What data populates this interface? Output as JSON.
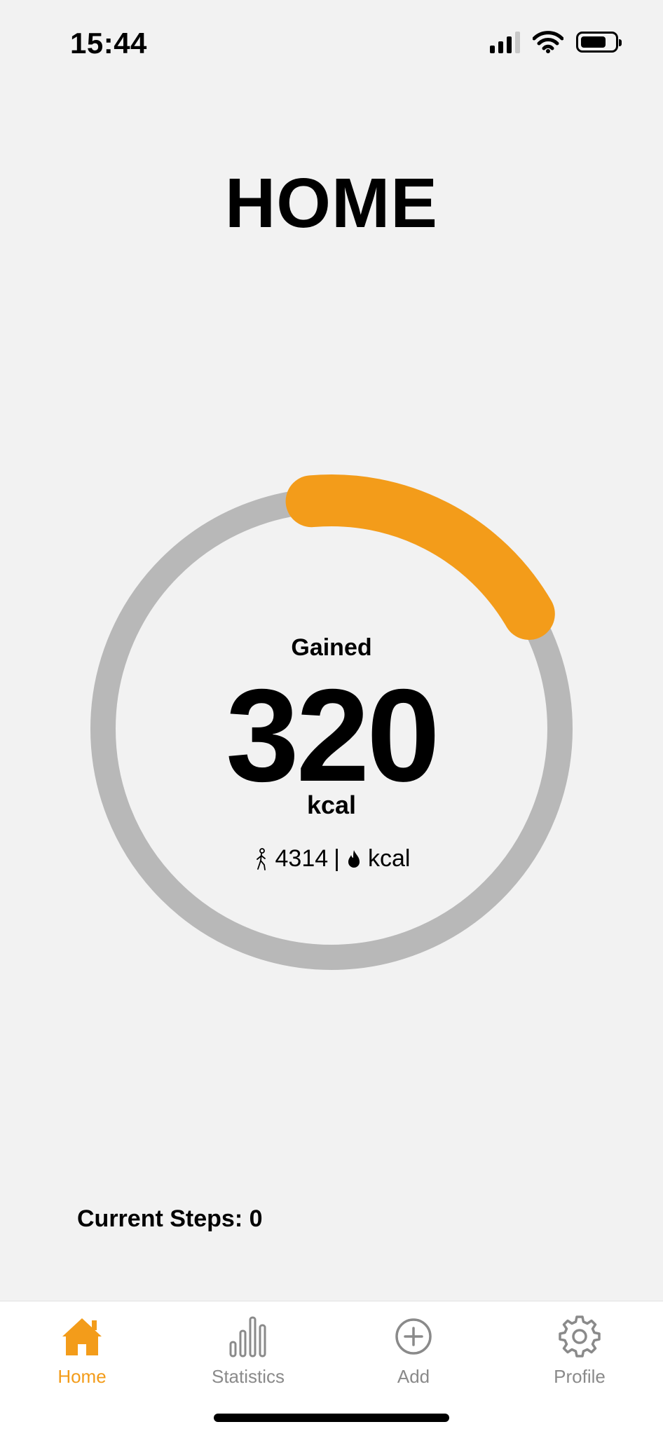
{
  "status_bar": {
    "time": "15:44",
    "battery_level": 0.75
  },
  "page": {
    "title": "HOME"
  },
  "ring": {
    "label": "Gained",
    "value": "320",
    "unit": "kcal",
    "steps": "4314",
    "separator": "|",
    "burned_unit": "kcal",
    "progress_fraction": 0.18,
    "track_color": "#b8b8b8",
    "progress_color": "#f39c1a"
  },
  "current_steps": {
    "text": "Current Steps: 0"
  },
  "tabs": [
    {
      "label": "Home",
      "icon": "home-icon",
      "active": true
    },
    {
      "label": "Statistics",
      "icon": "bar-chart-icon",
      "active": false
    },
    {
      "label": "Add",
      "icon": "plus-circle-icon",
      "active": false
    },
    {
      "label": "Profile",
      "icon": "gear-icon",
      "active": false
    }
  ],
  "colors": {
    "accent": "#f39c1a",
    "inactive": "#8a8a8a",
    "background": "#f2f2f2"
  }
}
